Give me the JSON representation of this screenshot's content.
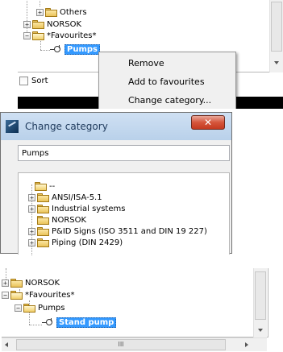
{
  "panel1": {
    "tree": [
      {
        "label": "Others",
        "expander": "+"
      },
      {
        "label": "NORSOK",
        "expander": "+"
      },
      {
        "label": "*Favourites*",
        "expander": "−"
      },
      {
        "label": "Pumps"
      }
    ],
    "sort_label": "Sort",
    "context_menu": [
      "Remove",
      "Add to favourites",
      "Change category..."
    ]
  },
  "dialog": {
    "title": "Change category",
    "close_glyph": "✕",
    "input_value": "Pumps",
    "root_label": "--",
    "categories": [
      {
        "label": "ANSI/ISA-5.1",
        "expander": "+"
      },
      {
        "label": "Industrial systems",
        "expander": "+"
      },
      {
        "label": "NORSOK",
        "expander": ""
      },
      {
        "label": "P&ID Signs (ISO 3511 and DIN 19 227)",
        "expander": "+"
      },
      {
        "label": "Piping (DIN 2429)",
        "expander": "+"
      }
    ]
  },
  "panel3": {
    "tree": [
      {
        "label": "NORSOK",
        "expander": "+"
      },
      {
        "label": "*Favourites*",
        "expander": "−"
      },
      {
        "label": "Pumps",
        "expander": "−"
      },
      {
        "label": "Stand pump"
      }
    ],
    "hscroll_glyph": "III"
  },
  "colors": {
    "selection": "#3399ff",
    "titlebar": "#b9d1ea",
    "close": "#c43a20"
  }
}
